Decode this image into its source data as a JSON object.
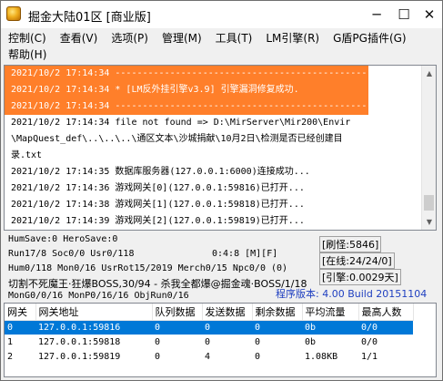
{
  "window": {
    "title": "掘金大陆01区 [商业版]",
    "min_glyph": "─",
    "max_glyph": "☐",
    "close_glyph": "✕"
  },
  "menu": [
    "控制(C)",
    "查看(V)",
    "选项(P)",
    "管理(M)",
    "工具(T)",
    "LM引擎(R)",
    "G盾PG插件(G)",
    "帮助(H)"
  ],
  "log": {
    "lines": [
      {
        "text": "2021/10/2 17:14:34 -------------------------------------------------",
        "highlight": true
      },
      {
        "text": "2021/10/2 17:14:34 * [LM反外挂引擎v3.9] 引擎漏洞修复成功.",
        "highlight": true
      },
      {
        "text": "2021/10/2 17:14:34 -------------------------------------------------",
        "highlight": true
      },
      {
        "text": "2021/10/2 17:14:34 file not found => D:\\MirServer\\Mir200\\Envir",
        "highlight": false
      },
      {
        "text": "\\MapQuest_def\\..\\..\\..\\通区文本\\沙城捐献\\10月2日\\检测是否已经创建目",
        "highlight": false
      },
      {
        "text": "录.txt",
        "highlight": false
      },
      {
        "text": "2021/10/2 17:14:35 数据库服务器(127.0.0.1:6000)连接成功...",
        "highlight": false
      },
      {
        "text": "2021/10/2 17:14:36 游戏网关[0](127.0.0.1:59816)已打开...",
        "highlight": false
      },
      {
        "text": "2021/10/2 17:14:38 游戏网关[1](127.0.0.1:59818)已打开...",
        "highlight": false
      },
      {
        "text": "2021/10/2 17:14:39 游戏网关[2](127.0.0.1:59819)已打开...",
        "highlight": false
      }
    ]
  },
  "status": {
    "hum_save": "HumSave:0 HeroSave:0",
    "run": "Run17/8 Soc0/0 Usr0/118",
    "clock": "0:4:8 [M][F]",
    "hum": "Hum0/118 Mon0/16 UsrRot15/2019 Merch0/15 Npc0/0 (0)",
    "boss": "切割不死魔王·狂爆BOSS,30/94 - 杀我全都爆@掘金魂·BOSS/1/18",
    "mon": "MonG0/0/16 MonP0/16/16 ObjRun0/16",
    "refresh": "[刷怪:5846]",
    "online": "[在线:24/24/0]",
    "engine": "[引擎:0.0029天]",
    "version": "程序版本: 4.00 Build 20151104"
  },
  "gate_table": {
    "columns": [
      "网关",
      "网关地址",
      "队列数据",
      "发送数据",
      "剩余数据",
      "平均流量",
      "最高人数"
    ],
    "rows": [
      [
        "0",
        "127.0.0.1:59816",
        "0",
        "0",
        "0",
        "0b",
        "0/0"
      ],
      [
        "1",
        "127.0.0.1:59818",
        "0",
        "0",
        "0",
        "0b",
        "0/0"
      ],
      [
        "2",
        "127.0.0.1:59819",
        "0",
        "4",
        "0",
        "1.08KB",
        "1/1"
      ]
    ],
    "selected_row": 0
  },
  "colors": {
    "log_highlight": "#ff7f2a",
    "selection": "#0078d7",
    "version_text": "#1f3fc0"
  }
}
